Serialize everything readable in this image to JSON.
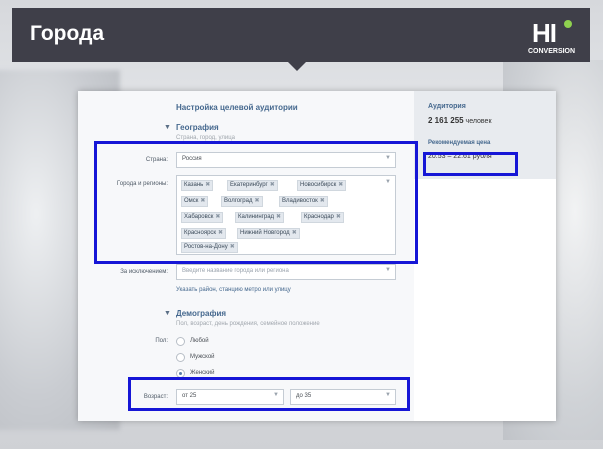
{
  "header": {
    "title": "Города",
    "logo_text": "HI",
    "logo_sub": "CONVERSION"
  },
  "form": {
    "title": "Настройка целевой аудитории",
    "geo": {
      "section": "География",
      "hint": "Страна, город, улица",
      "country_label": "Страна:",
      "country_value": "Россия",
      "cities_label": "Города и регионы:",
      "cities": [
        "Казань",
        "Екатеринбург",
        "Новосибирск",
        "Омск",
        "Волгоград",
        "Владивосток",
        "Хабаровск",
        "Калининград",
        "Краснодар",
        "Красноярск",
        "Нижний Новгород",
        "Ростов-на-Дону"
      ],
      "except_label": "За исключением:",
      "except_placeholder": "Введите название города или региона",
      "district_link": "Указать район, станцию метро или улицу"
    },
    "demo": {
      "section": "Демография",
      "hint": "Пол, возраст, день рождения, семейное положение",
      "gender_label": "Пол:",
      "gender_options": [
        "Любой",
        "Мужской",
        "Женский"
      ],
      "gender_selected": "Женский",
      "age_label": "Возраст:",
      "age_from": "от 25",
      "age_to": "до 35"
    }
  },
  "sidebar": {
    "audience_title": "Аудитория",
    "audience_value": "2 161 255",
    "audience_unit": "человек",
    "price_title": "Рекомендуемая цена",
    "price_range": "20.53 – 22.61 рубля"
  },
  "icons": {
    "remove": "close-icon",
    "dropdown": "chevron-down-icon"
  },
  "colors": {
    "highlight": "#1616d6",
    "header_bg": "#3f3f49",
    "accent": "#45688e"
  }
}
